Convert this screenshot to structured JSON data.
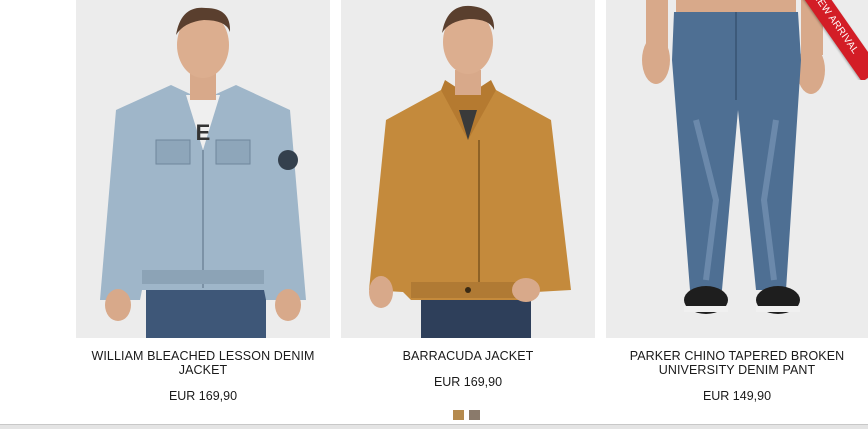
{
  "products": [
    {
      "name_line1": "WILLIAM BLEACHED LESSON DENIM",
      "name_line2": "JACKET",
      "price": "EUR 169,90",
      "image_icon": "denim-jacket-model-photo"
    },
    {
      "name_line1": "BARRACUDA JACKET",
      "name_line2": "",
      "price": "EUR 169,90",
      "image_icon": "leather-jacket-model-photo"
    },
    {
      "name_line1": "PARKER CHINO TAPERED BROKEN",
      "name_line2": "UNIVERSITY DENIM PANT",
      "price": "EUR 149,90",
      "image_icon": "denim-pant-model-photo",
      "badge": "NEW ARRIVAL"
    }
  ],
  "colors": {
    "badge": "#d31d26",
    "swatch_1": "#b58a4e",
    "swatch_2": "#8a7a6b",
    "text": "#1a1a1a"
  },
  "pager": {
    "swatches": [
      "#b58a4e",
      "#8a7a6b"
    ]
  }
}
